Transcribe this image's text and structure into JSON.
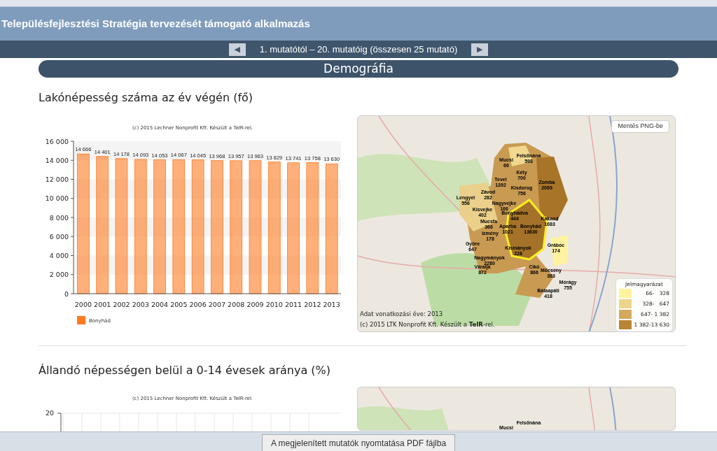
{
  "header": {
    "title": "Településfejlesztési Stratégia tervezését támogató alkalmazás"
  },
  "pager": {
    "prev": "◀",
    "text": "1. mutatótól – 20. mutatóig (összesen 25 mutató)",
    "next": "▶"
  },
  "section": {
    "title": "Demográfia"
  },
  "indicators": [
    {
      "title": "Lakónépesség száma az év végén (fő)",
      "chart_credit": "(c) 2015 Lechner Nonprofit Kft. Készült a TeIR-rel.",
      "chart_data": {
        "type": "bar",
        "categories": [
          "2000",
          "2001",
          "2002",
          "2003",
          "2004",
          "2005",
          "2006",
          "2007",
          "2008",
          "2009",
          "2010",
          "2011",
          "2012",
          "2013"
        ],
        "series": [
          {
            "name": "Bonyhád",
            "color": "#ff7a21",
            "values": [
              14666,
              14401,
              14178,
              14093,
              14053,
              14067,
              14045,
              13968,
              13957,
              13963,
              13829,
              13741,
              13758,
              13630
            ]
          }
        ],
        "ylim": [
          0,
          16000
        ],
        "yticks": [
          {
            "value": 0,
            "label": "0"
          },
          {
            "value": 2000,
            "label": "2 000"
          },
          {
            "value": 4000,
            "label": "4 000"
          },
          {
            "value": 6000,
            "label": "6 000"
          },
          {
            "value": 8000,
            "label": "8 000"
          },
          {
            "value": 10000,
            "label": "10 000"
          },
          {
            "value": 12000,
            "label": "12 000"
          },
          {
            "value": 14000,
            "label": "14 000"
          },
          {
            "value": 16000,
            "label": "16 000"
          }
        ],
        "value_labels": [
          "14 666",
          "14 401",
          "14 178",
          "14 093",
          "14 053",
          "14 067",
          "14 045",
          "13 968",
          "13 957",
          "13 963",
          "13 829",
          "13 741",
          "13 758",
          "13 630"
        ]
      },
      "map": {
        "save_button": "Mentés PNG-be",
        "data_year": "Adat vonatkozási éve: 2013",
        "credit": "(c) 2015 LTK Nonprofit Kft. Készült a **TeIR**-rel.",
        "settlements": [
          {
            "name": "Felsőnána",
            "value": "598"
          },
          {
            "name": "Mucsi",
            "value": "66"
          },
          {
            "name": "Kéty",
            "value": "700"
          },
          {
            "name": "Tevel",
            "value": "1392"
          },
          {
            "name": "Zomba",
            "value": "2069"
          },
          {
            "name": "Závod",
            "value": "282"
          },
          {
            "name": "Kisdorog",
            "value": "756"
          },
          {
            "name": "Lengyel",
            "value": "556"
          },
          {
            "name": "Kisvejke",
            "value": "402"
          },
          {
            "name": "Nagyvejke",
            "value": "166"
          },
          {
            "name": "Mucsfa",
            "value": "366"
          },
          {
            "name": "Bonyhádva",
            "value": "444"
          },
          {
            "name": "Aparha",
            "value": "1021"
          },
          {
            "name": "Kakasd",
            "value": "1683"
          },
          {
            "name": "Bonyhád",
            "value": "13630"
          },
          {
            "name": "Izmény",
            "value": "178"
          },
          {
            "name": "Györe",
            "value": "647"
          },
          {
            "name": "Kismányok",
            "value": "228"
          },
          {
            "name": "Nagymányok",
            "value": "2280"
          },
          {
            "name": "Grábóc",
            "value": "174"
          },
          {
            "name": "Váralja",
            "value": "872"
          },
          {
            "name": "Cikó",
            "value": "866"
          },
          {
            "name": "Mőcsény",
            "value": "383"
          },
          {
            "name": "Mórágy",
            "value": "755"
          },
          {
            "name": "Bátaapáti",
            "value": "418"
          }
        ],
        "legend": {
          "title": "Jelmagyarázat",
          "items": [
            {
              "label": "66-   328",
              "color": "#fff3a0"
            },
            {
              "label": "328-   647",
              "color": "#ecd48a"
            },
            {
              "label": "647- 1 382",
              "color": "#d4a95c"
            },
            {
              "label": "1 382-13 630",
              "color": "#b88532"
            }
          ]
        }
      }
    },
    {
      "title": "Állandó népességen belül a 0-14 évesek aránya (%)",
      "chart_credit": "(c) 2015 Lechner Nonprofit Kft. Készült a TeIR-rel.",
      "chart_top_tick": "20",
      "map": {
        "settlements": [
          {
            "name": "Felsőnána"
          },
          {
            "name": "Mucsi"
          }
        ]
      }
    }
  ],
  "footer": {
    "print_button": "A megjelenített mutatók nyomtatása PDF fájlba"
  }
}
